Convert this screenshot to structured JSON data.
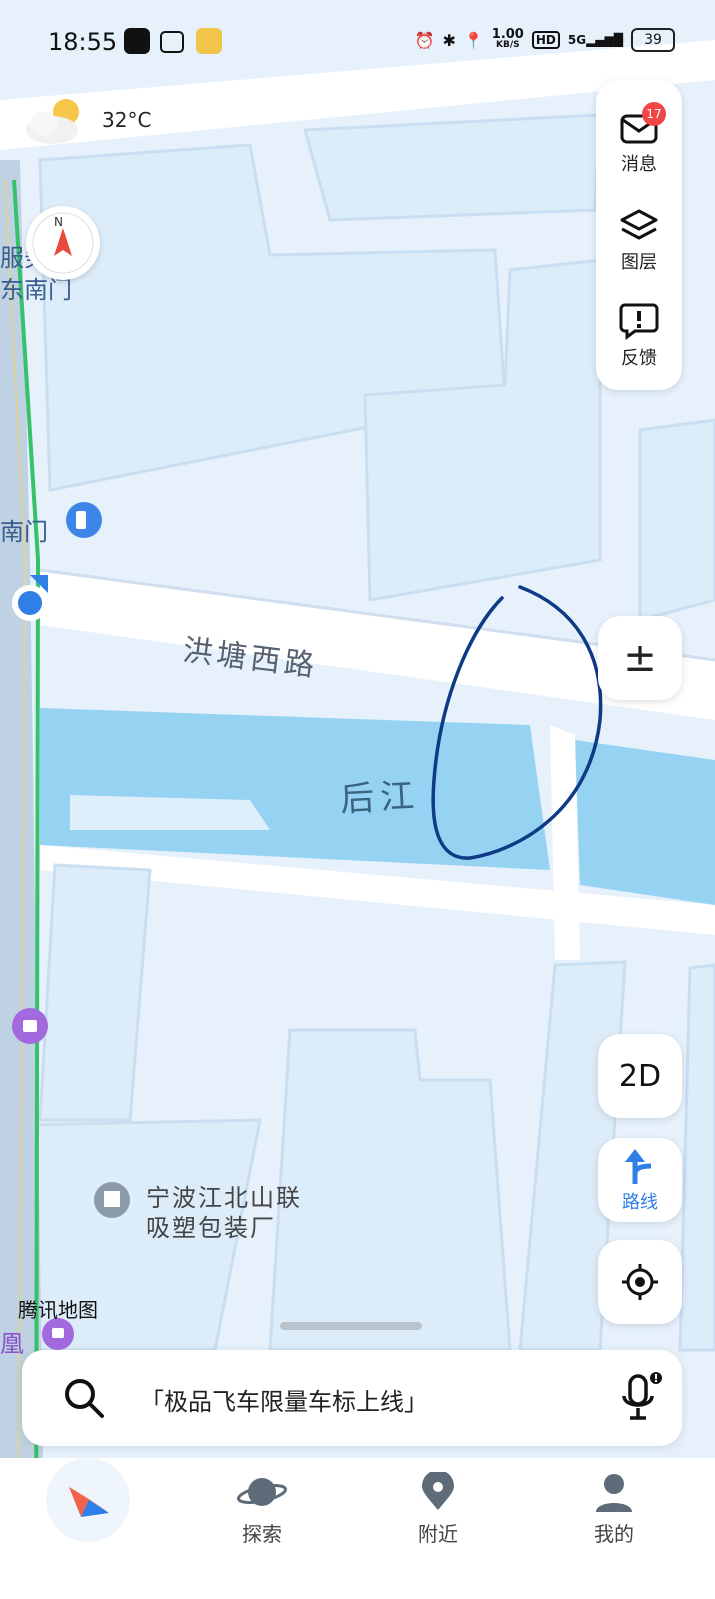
{
  "status_bar": {
    "time": "18:55",
    "speed_value": "1.00",
    "speed_unit": "KB/S",
    "hd": "HD",
    "net": "5G",
    "battery": "39"
  },
  "weather": {
    "temp": "32°C"
  },
  "right_panel": {
    "messages_label": "消息",
    "messages_badge": "17",
    "layers_label": "图层",
    "feedback_label": "反馈"
  },
  "map_labels": {
    "poi_top1": "服务",
    "poi_top2": "东南门",
    "gate": "南门",
    "road": "洪塘西路",
    "river": "后江",
    "factory_line1": "宁波江北山联",
    "factory_line2": "吸塑包装厂",
    "edge_char": "凰",
    "logo": "腾讯地图"
  },
  "controls": {
    "zoom_label": "±",
    "mode_label": "2D",
    "route_label": "路线"
  },
  "search": {
    "placeholder": "「极品飞车限量车标上线」"
  },
  "tabbar": {
    "explore": "探索",
    "nearby": "附近",
    "mine": "我的"
  },
  "colors": {
    "road_green": "#36c26a",
    "river": "#96d3f3",
    "accent": "#2f7fe6",
    "annotation": "#0e3a86"
  }
}
